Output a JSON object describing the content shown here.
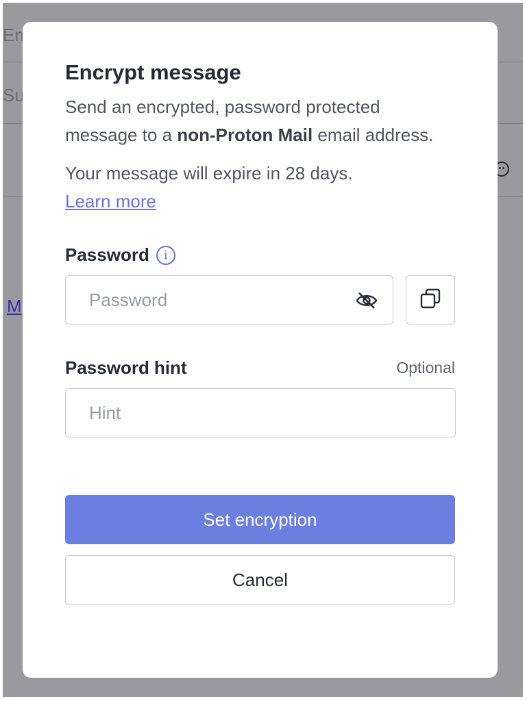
{
  "background": {
    "email_field_fragment": "Em",
    "subject_field_fragment": "Su",
    "link_fragment": "M"
  },
  "modal": {
    "title": "Encrypt message",
    "description_before": "Send an encrypted, password protected message to a ",
    "description_bold": "non-Proton Mail",
    "description_after": " email address.",
    "expiry_text": "Your message will expire in 28 days.",
    "learn_more": "Learn more",
    "password_label": "Password",
    "info_glyph": "i",
    "password_placeholder": "Password",
    "hint_label": "Password hint",
    "hint_optional": "Optional",
    "hint_placeholder": "Hint",
    "set_button": "Set encryption",
    "cancel_button": "Cancel"
  },
  "colors": {
    "primary_button": "#6b7fe0",
    "link": "#6a70d8",
    "overlay": "#9a9a9e"
  },
  "icons": {
    "password_visibility": "eye-slash-icon",
    "copy": "copy-icon",
    "info": "info-icon",
    "emoji": "emoji-icon"
  }
}
